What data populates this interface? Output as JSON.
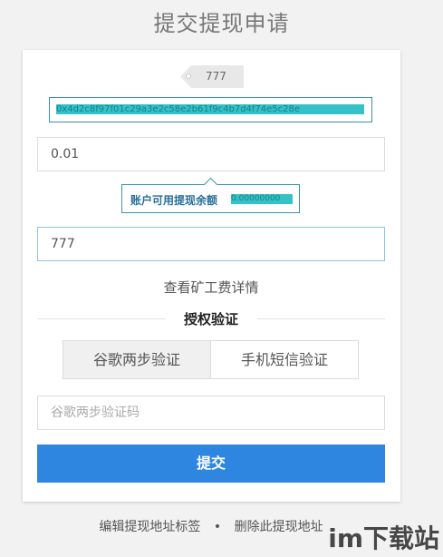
{
  "page": {
    "title": "提交提现申请"
  },
  "address": {
    "tag": "777",
    "value": "0x4d2c8f97f01c29a3e2c58e2b61f9c4b7d4f74e5c28e"
  },
  "amount": {
    "value": "0.01"
  },
  "balance": {
    "label": "账户可用提现余额",
    "value": "0.00000000"
  },
  "fee": {
    "value": "777",
    "details_link": "查看矿工费详情"
  },
  "auth": {
    "title": "授权验证",
    "tabs": [
      {
        "label": "谷歌两步验证"
      },
      {
        "label": "手机短信验证"
      }
    ],
    "code_placeholder": "谷歌两步验证码"
  },
  "submit": {
    "label": "提交"
  },
  "footer": {
    "edit_label": "编辑提现地址标签",
    "separator": "•",
    "delete_label": "删除此提现地址"
  },
  "watermark": {
    "text": "im下载站"
  },
  "colors": {
    "primary": "#2f86e0",
    "tip_border": "#3a8fb0",
    "redacted": "#34c2c8"
  }
}
